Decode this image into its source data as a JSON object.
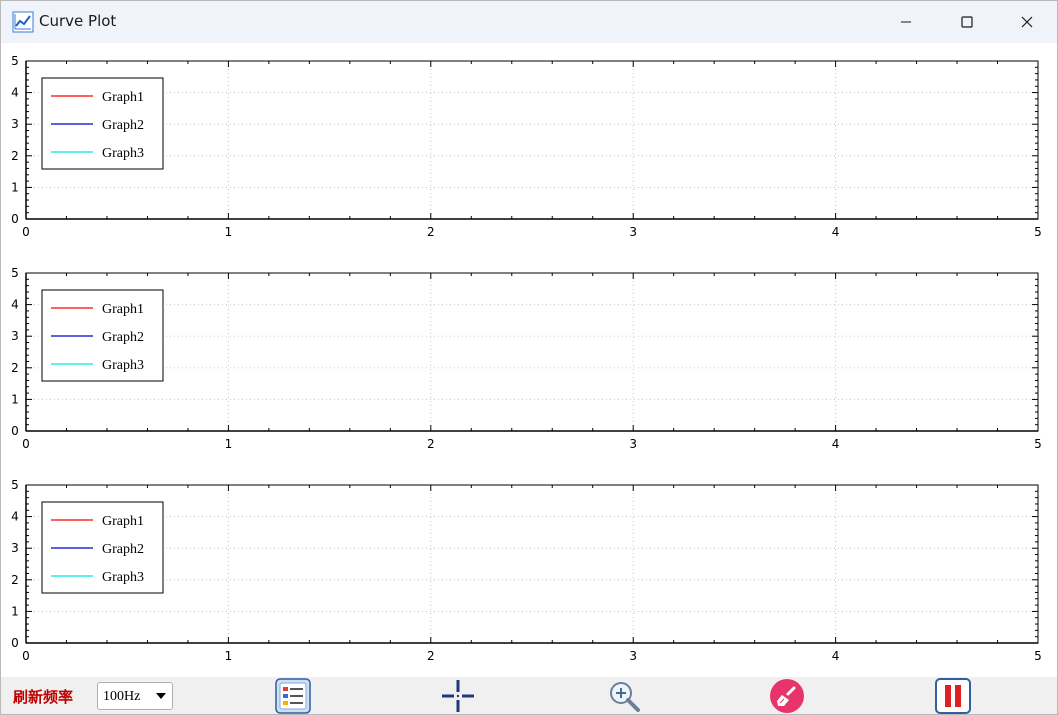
{
  "window": {
    "title": "Curve Plot",
    "app_icon": "chart-line-icon",
    "controls": {
      "minimize": "minimize-icon",
      "maximize": "maximize-icon",
      "close": "close-icon"
    }
  },
  "colors": {
    "graph1": "#ff0000",
    "graph2": "#0000cc",
    "graph3": "#00e6e6",
    "toolbar_label": "#c00000"
  },
  "chart_data": [
    {
      "type": "line",
      "xlim": [
        0,
        5
      ],
      "ylim": [
        0,
        5
      ],
      "x_ticks": [
        "0",
        "1",
        "2",
        "3",
        "4",
        "5"
      ],
      "y_ticks": [
        "0",
        "1",
        "2",
        "3",
        "4",
        "5"
      ],
      "grid": true,
      "legend_position": "top-left",
      "series": [
        {
          "name": "Graph1",
          "values": []
        },
        {
          "name": "Graph2",
          "values": []
        },
        {
          "name": "Graph3",
          "values": []
        }
      ]
    },
    {
      "type": "line",
      "xlim": [
        0,
        5
      ],
      "ylim": [
        0,
        5
      ],
      "x_ticks": [
        "0",
        "1",
        "2",
        "3",
        "4",
        "5"
      ],
      "y_ticks": [
        "0",
        "1",
        "2",
        "3",
        "4",
        "5"
      ],
      "grid": true,
      "legend_position": "top-left",
      "series": [
        {
          "name": "Graph1",
          "values": []
        },
        {
          "name": "Graph2",
          "values": []
        },
        {
          "name": "Graph3",
          "values": []
        }
      ]
    },
    {
      "type": "line",
      "xlim": [
        0,
        5
      ],
      "ylim": [
        0,
        5
      ],
      "x_ticks": [
        "0",
        "1",
        "2",
        "3",
        "4",
        "5"
      ],
      "y_ticks": [
        "0",
        "1",
        "2",
        "3",
        "4",
        "5"
      ],
      "grid": true,
      "legend_position": "top-left",
      "series": [
        {
          "name": "Graph1",
          "values": []
        },
        {
          "name": "Graph2",
          "values": []
        },
        {
          "name": "Graph3",
          "values": []
        }
      ]
    }
  ],
  "toolbar": {
    "rate_label": "刷新频率",
    "rate_value": "100Hz",
    "buttons": [
      {
        "icon": "legend-list-icon"
      },
      {
        "icon": "crosshair-icon"
      },
      {
        "icon": "zoom-in-icon"
      },
      {
        "icon": "clear-broom-icon"
      },
      {
        "icon": "pause-icon"
      }
    ]
  }
}
